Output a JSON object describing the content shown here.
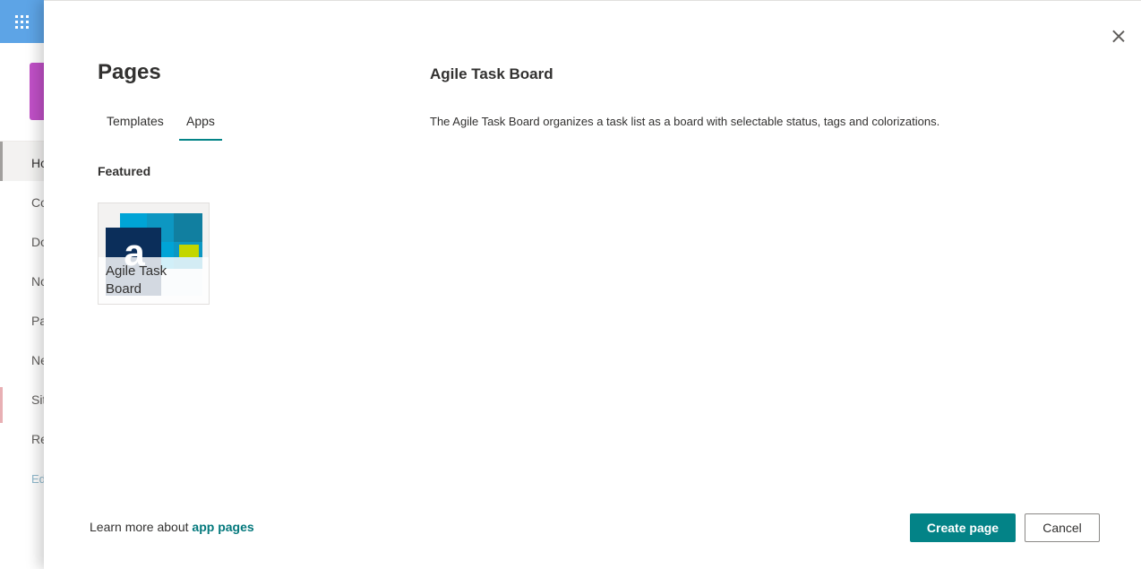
{
  "background_site": {
    "nav_items": [
      {
        "label": "Ho"
      },
      {
        "label": "Co"
      },
      {
        "label": "Do"
      },
      {
        "label": "No"
      },
      {
        "label": "Pa"
      },
      {
        "label": "Ne"
      },
      {
        "label": "Sit"
      },
      {
        "label": "Re"
      },
      {
        "label": "Ed"
      }
    ]
  },
  "panel": {
    "title": "Pages",
    "tabs": [
      {
        "label": "Templates",
        "selected": false
      },
      {
        "label": "Apps",
        "selected": true
      }
    ],
    "section_label": "Featured",
    "apps": [
      {
        "name": "Agile Task Board",
        "thumbnail_letter": "a",
        "selected": true
      }
    ],
    "detail": {
      "title": "Agile Task Board",
      "description": "The Agile Task Board organizes a task list as a board with selectable status, tags and colorizations."
    },
    "footer": {
      "learn_more_prefix": "Learn more about",
      "learn_more_link": "app pages",
      "create_label": "Create page",
      "cancel_label": "Cancel"
    }
  },
  "colors": {
    "accent": "#038387",
    "waffle_bar": "#5da4e6",
    "site_logo": "#c050c7"
  }
}
